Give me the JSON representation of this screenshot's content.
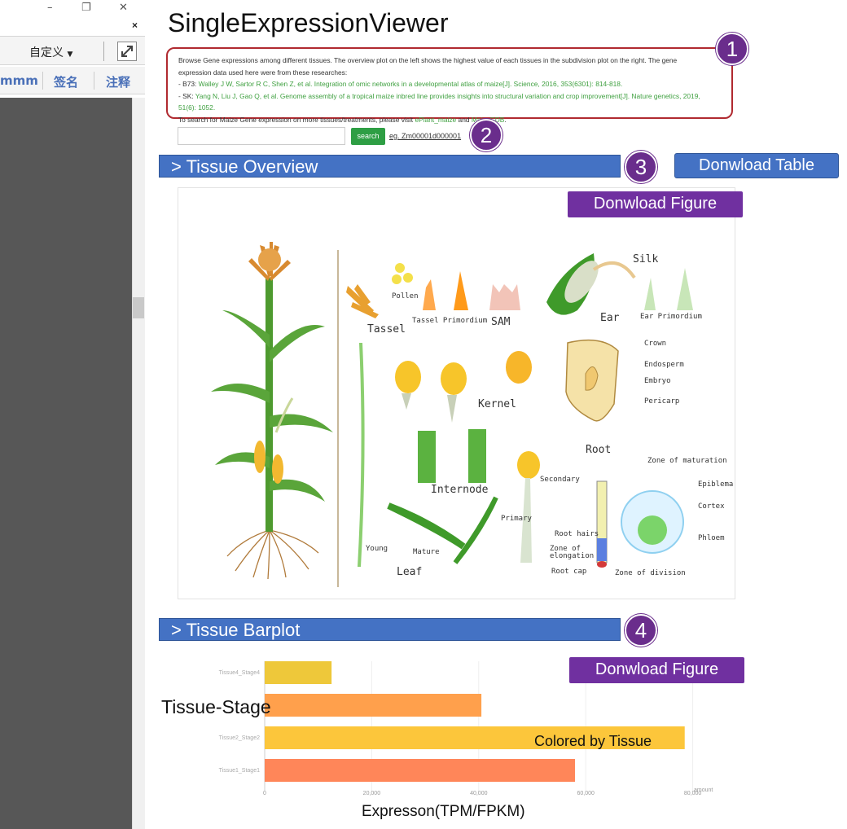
{
  "window": {
    "minimize": "–",
    "restore": "❐",
    "close": "✕",
    "pin": "×"
  },
  "left_toolbar": {
    "custom_label": "自定义",
    "tab_mmm": "mmm",
    "tab_sign": "签名",
    "tab_annotate": "注释"
  },
  "app": {
    "title": "SingleExpressionViewer"
  },
  "description": {
    "line1": "Browse Gene expressions among different tissues. The overview plot on the left shows the highest value of each tissues in the subdivision plot on the right. The gene",
    "line2": "expression data used here were from these researches:",
    "b73_prefix": "- B73: ",
    "b73_ref": "Walley J W, Sartor R C, Shen Z, et al. Integration of omic networks in a developmental atlas of maize[J]. Science, 2016, 353(6301): 814-818.",
    "sk_prefix": "- SK: ",
    "sk_ref": "Yang N, Liu J, Gao Q, et al. Genome assembly of a tropical maize inbred line provides insights into structural variation and crop improvement[J]. Nature genetics, 2019,",
    "sk_ref2": "51(6): 1052.",
    "more_prefix": "To search for Maize Gene expression on more tissues/treatments, please visit ",
    "link1": "ePlant_maize",
    "and": " and ",
    "link2": "MaizeGDB",
    "end": "."
  },
  "search": {
    "button": "search",
    "example": "eg. Zm00001d000001",
    "placeholder": ""
  },
  "badges": {
    "b1": "1",
    "b2": "2",
    "b3": "3",
    "b4": "4"
  },
  "sections": {
    "overview": "> Tissue Overview",
    "barplot": "> Tissue Barplot"
  },
  "buttons": {
    "download_table": "Donwload Table",
    "download_figure": "Donwload Figure"
  },
  "plant_labels": {
    "silk": "Silk",
    "pollen": "Pollen",
    "tassel": "Tassel",
    "tassel_primordium": "Tassel Primordium",
    "sam": "SAM",
    "ear": "Ear",
    "ear_primordium": "Ear Primordium",
    "crown": "Crown",
    "endosperm": "Endosperm",
    "embryo": "Embryo",
    "pericarp": "Pericarp",
    "kernel": "Kernel",
    "internode": "Internode",
    "root": "Root",
    "secondary": "Secondary",
    "primary": "Primary",
    "zone_maturation": "Zone of maturation",
    "epiblema": "Epiblema",
    "cortex": "Cortex",
    "phloem": "Phloem",
    "root_hairs": "Root hairs",
    "zone_elongation_1": "Zone of",
    "zone_elongation_2": "elongation",
    "root_cap": "Root cap",
    "zone_division": "Zone of division",
    "young": "Young",
    "mature": "Mature",
    "leaf": "Leaf"
  },
  "annotations": {
    "tissue_stage": "Tissue-Stage",
    "colored_by": "Colored by Tissue",
    "x_title": "Expresson(TPM/FPKM)"
  },
  "colors": {
    "purple": "#7030a0",
    "blue": "#4472c4",
    "red": "#b02a30",
    "green": "#2e9e44"
  },
  "chart_data": {
    "type": "bar",
    "orientation": "horizontal",
    "categories": [
      "Tissue4_Stage4",
      "",
      "Tissue2_Stage2",
      "Tissue1_Stage1"
    ],
    "values": [
      12500,
      40500,
      78500,
      58000
    ],
    "bar_colors": [
      "#eec83a",
      "#ffa04c",
      "#fcc63b",
      "#ff8659"
    ],
    "x_ticks": [
      "0",
      "20,000",
      "40,000",
      "60,000",
      "80,000"
    ],
    "x_tick_values": [
      0,
      20000,
      40000,
      60000,
      80000
    ],
    "xlim": [
      0,
      86000
    ],
    "xunit": "amount",
    "xlabel": "Expresson(TPM/FPKM)",
    "ylabel": "Tissue-Stage",
    "grid": true
  }
}
